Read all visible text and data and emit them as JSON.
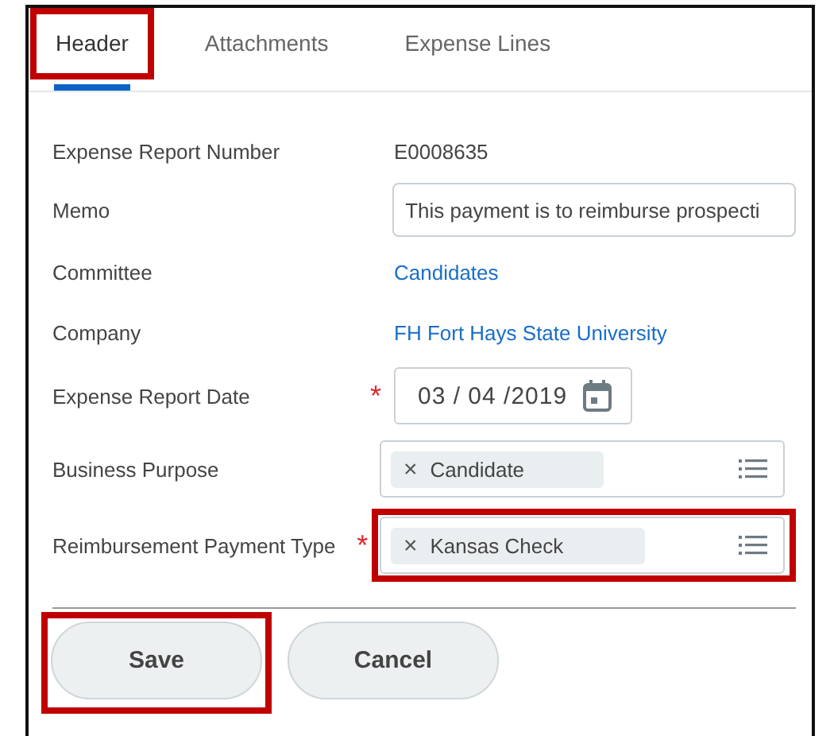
{
  "tabs": [
    {
      "label": "Header",
      "selected": true,
      "highlighted": true
    },
    {
      "label": "Attachments",
      "selected": false,
      "highlighted": false
    },
    {
      "label": "Expense Lines",
      "selected": false,
      "highlighted": false
    }
  ],
  "fields": [
    {
      "kind": "text",
      "label": "Expense Report Number",
      "required": false,
      "value": "E0008635"
    },
    {
      "kind": "input",
      "label": "Memo",
      "required": false,
      "value": "This payment is to reimburse prospecti"
    },
    {
      "kind": "link",
      "label": "Committee",
      "required": false,
      "value": "Candidates"
    },
    {
      "kind": "link",
      "label": "Company",
      "required": false,
      "value": "FH Fort Hays State University"
    },
    {
      "kind": "date",
      "label": "Expense Report Date",
      "required": true,
      "value": "03 / 04 /2019"
    },
    {
      "kind": "multiselect",
      "label": "Business Purpose",
      "required": false,
      "value": "Candidate",
      "remove": "×",
      "highlighted": false
    },
    {
      "kind": "multiselect",
      "label": "Reimbursement Payment Type",
      "required": true,
      "value": "Kansas Check",
      "remove": "×",
      "highlighted": true
    }
  ],
  "required_mark": "*",
  "buttons": [
    {
      "label": "Save",
      "highlighted": true
    },
    {
      "label": "Cancel",
      "highlighted": false
    }
  ]
}
